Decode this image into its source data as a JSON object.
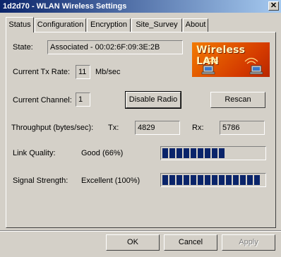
{
  "window": {
    "title": "1d2d70 - WLAN Wireless Settings",
    "close_glyph": "✕"
  },
  "tabs": [
    {
      "label": "Status",
      "active": true
    },
    {
      "label": "Configuration",
      "active": false
    },
    {
      "label": "Encryption",
      "active": false
    },
    {
      "label": "Site_Survey",
      "active": false
    },
    {
      "label": "About",
      "active": false
    }
  ],
  "status": {
    "state_label": "State:",
    "state_value": "Associated - 00:02:6F:09:3E:2B",
    "tx_rate_label": "Current Tx Rate:",
    "tx_rate_value": "11",
    "tx_rate_unit": "Mb/sec",
    "channel_label": "Current Channel:",
    "channel_value": "1",
    "disable_radio_label": "Disable Radio",
    "rescan_label": "Rescan",
    "throughput_label": "Throughput (bytes/sec):",
    "tx_label": "Tx:",
    "tx_value": "4829",
    "rx_label": "Rx:",
    "rx_value": "5786",
    "link_quality_label": "Link Quality:",
    "link_quality_value": "Good (66%)",
    "link_quality_percent": 66,
    "signal_strength_label": "Signal Strength:",
    "signal_strength_value": "Excellent (100%)",
    "signal_strength_percent": 100
  },
  "logo": {
    "text": "Wireless LAN",
    "icon": "wireless-laptops-icon"
  },
  "footer": {
    "ok_label": "OK",
    "cancel_label": "Cancel",
    "apply_label": "Apply"
  },
  "colors": {
    "titlebar": "#0a246a",
    "bar": "#0a246a",
    "logo": "#e05a00",
    "face": "#d4d0c8"
  }
}
